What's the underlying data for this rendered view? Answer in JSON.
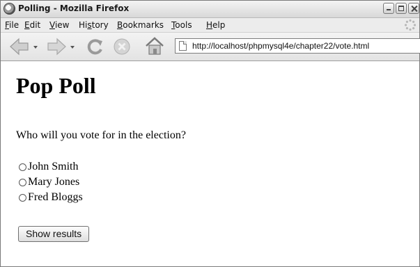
{
  "window": {
    "title": "Polling - Mozilla Firefox"
  },
  "menu": [
    {
      "label_u": "F",
      "label_rest": "ile"
    },
    {
      "label_u": "E",
      "label_rest": "dit"
    },
    {
      "label_u": "V",
      "label_rest": "iew"
    },
    {
      "label_pre": "Hi",
      "label_u": "s",
      "label_rest": "tory"
    },
    {
      "label_u": "B",
      "label_rest": "ookmarks"
    },
    {
      "label_u": "T",
      "label_rest": "ools"
    },
    {
      "label_u": "H",
      "label_rest": "elp"
    }
  ],
  "address": {
    "url": "http://localhost/phpmysql4e/chapter22/vote.html"
  },
  "page": {
    "heading": "Pop Poll",
    "question": "Who will you vote for in the election?",
    "options": [
      "John Smith",
      "Mary Jones",
      "Fred Bloggs"
    ],
    "button_label": "Show results"
  },
  "icons": {
    "back": "back-arrow-icon",
    "forward": "forward-arrow-icon",
    "reload": "reload-icon",
    "stop": "stop-icon",
    "home": "home-icon",
    "page": "page-icon",
    "throbber": "throbber-icon"
  }
}
